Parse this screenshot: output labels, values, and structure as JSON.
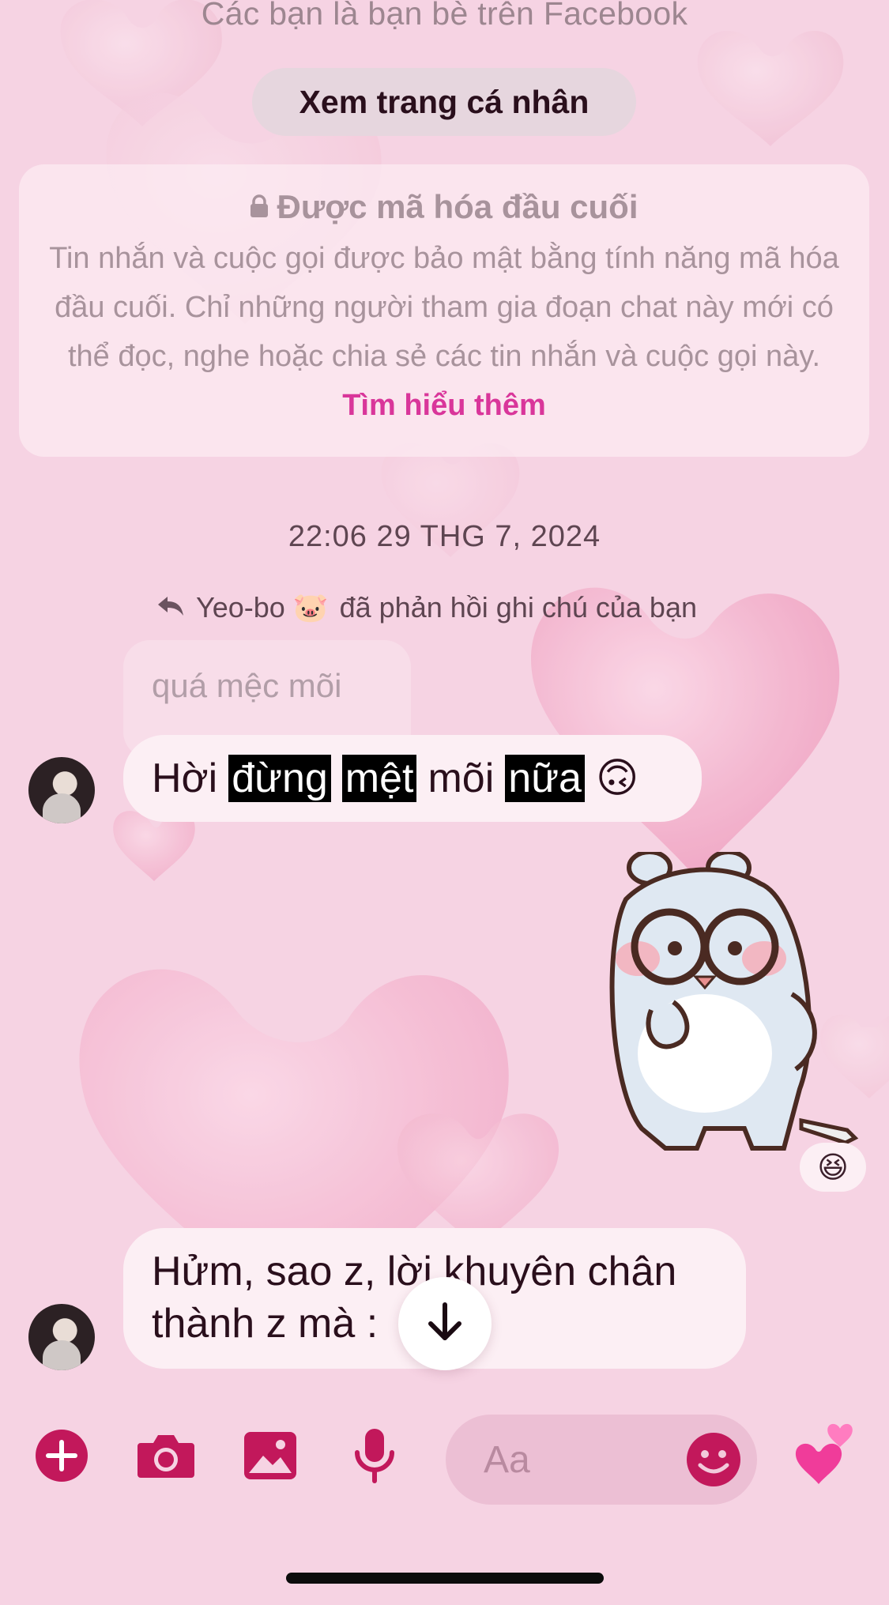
{
  "colors": {
    "background": "#f6d3e3",
    "accent": "#c2185b",
    "link": "#d9369a",
    "bubble": "#fcefF4"
  },
  "header": {
    "friends_text": "Các bạn là bạn bè trên Facebook",
    "profile_button": "Xem trang cá nhân"
  },
  "encryption": {
    "title": "Được mã hóa đầu cuối",
    "body": "Tin nhắn và cuộc gọi được bảo mật bằng tính năng mã hóa đầu cuối. Chỉ những người tham gia đoạn chat này mới có thể đọc, nghe hoặc chia sẻ các tin nhắn và cuộc gọi này.",
    "link": "Tìm hiểu thêm",
    "icon": "lock-icon"
  },
  "timestamp": "22:06 29 THG 7, 2024",
  "reply_note": {
    "icon": "reply-icon",
    "name": "Yeo-bo 🐷",
    "text": "đã phản hồi ghi chú của bạn"
  },
  "messages": [
    {
      "quoted": "quá mệc mõi",
      "words": [
        "Hời",
        "đừng",
        "mệt",
        "mõi",
        "nữa"
      ],
      "emoji": "🙃"
    },
    {
      "sticker": "bear-sticker",
      "reaction": "😆"
    },
    {
      "text": "Hửm, sao z, lời khuyên chân thành z mà :"
    }
  ],
  "composer": {
    "placeholder": "Aa",
    "tools": [
      "plus-icon",
      "camera-icon",
      "image-icon",
      "mic-icon"
    ],
    "emoji_icon": "smiley-icon",
    "send_icon": "hearts-icon",
    "send_emoji": "💕"
  },
  "scroll_button_icon": "arrow-down-icon"
}
